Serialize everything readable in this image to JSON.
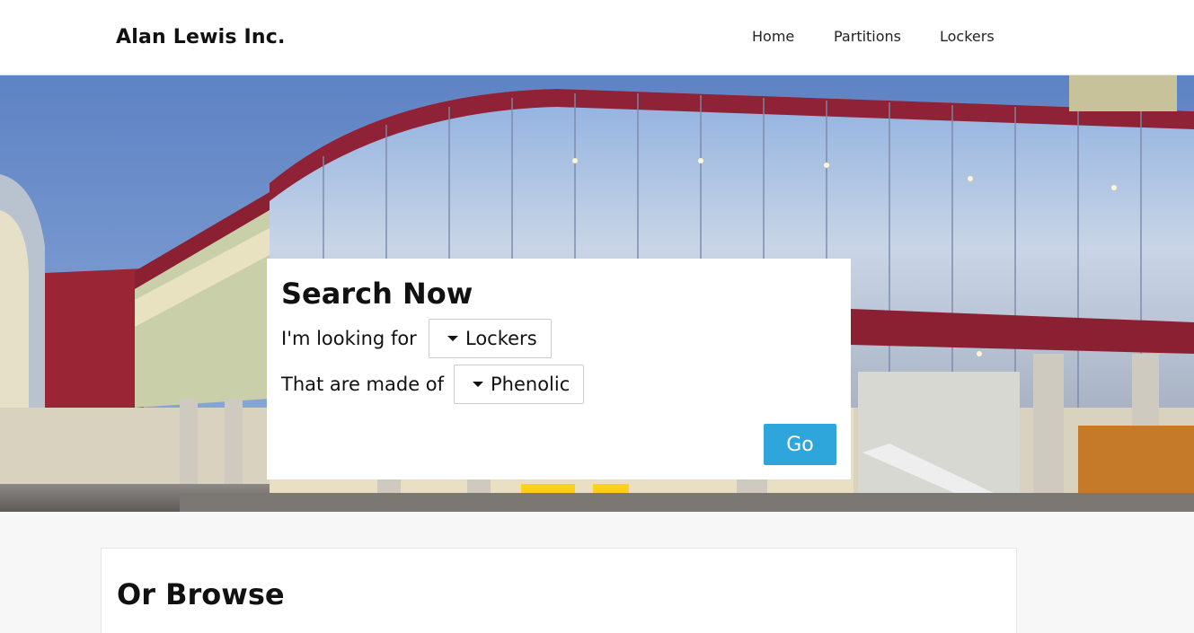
{
  "brand": "Alan Lewis Inc.",
  "nav": {
    "items": [
      "Home",
      "Partitions",
      "Lockers"
    ]
  },
  "search": {
    "title": "Search Now",
    "looking_for_label": "I'm looking for",
    "looking_for_value": "Lockers",
    "made_of_label": "That are made of",
    "made_of_value": "Phenolic",
    "go_label": "Go"
  },
  "browse": {
    "title": "Or Browse"
  },
  "colors": {
    "accent": "#2ea6dc",
    "background": "#f7f7f7",
    "building_red": "#8e2233"
  },
  "icons": {
    "dropdown": "caret-down-icon"
  }
}
